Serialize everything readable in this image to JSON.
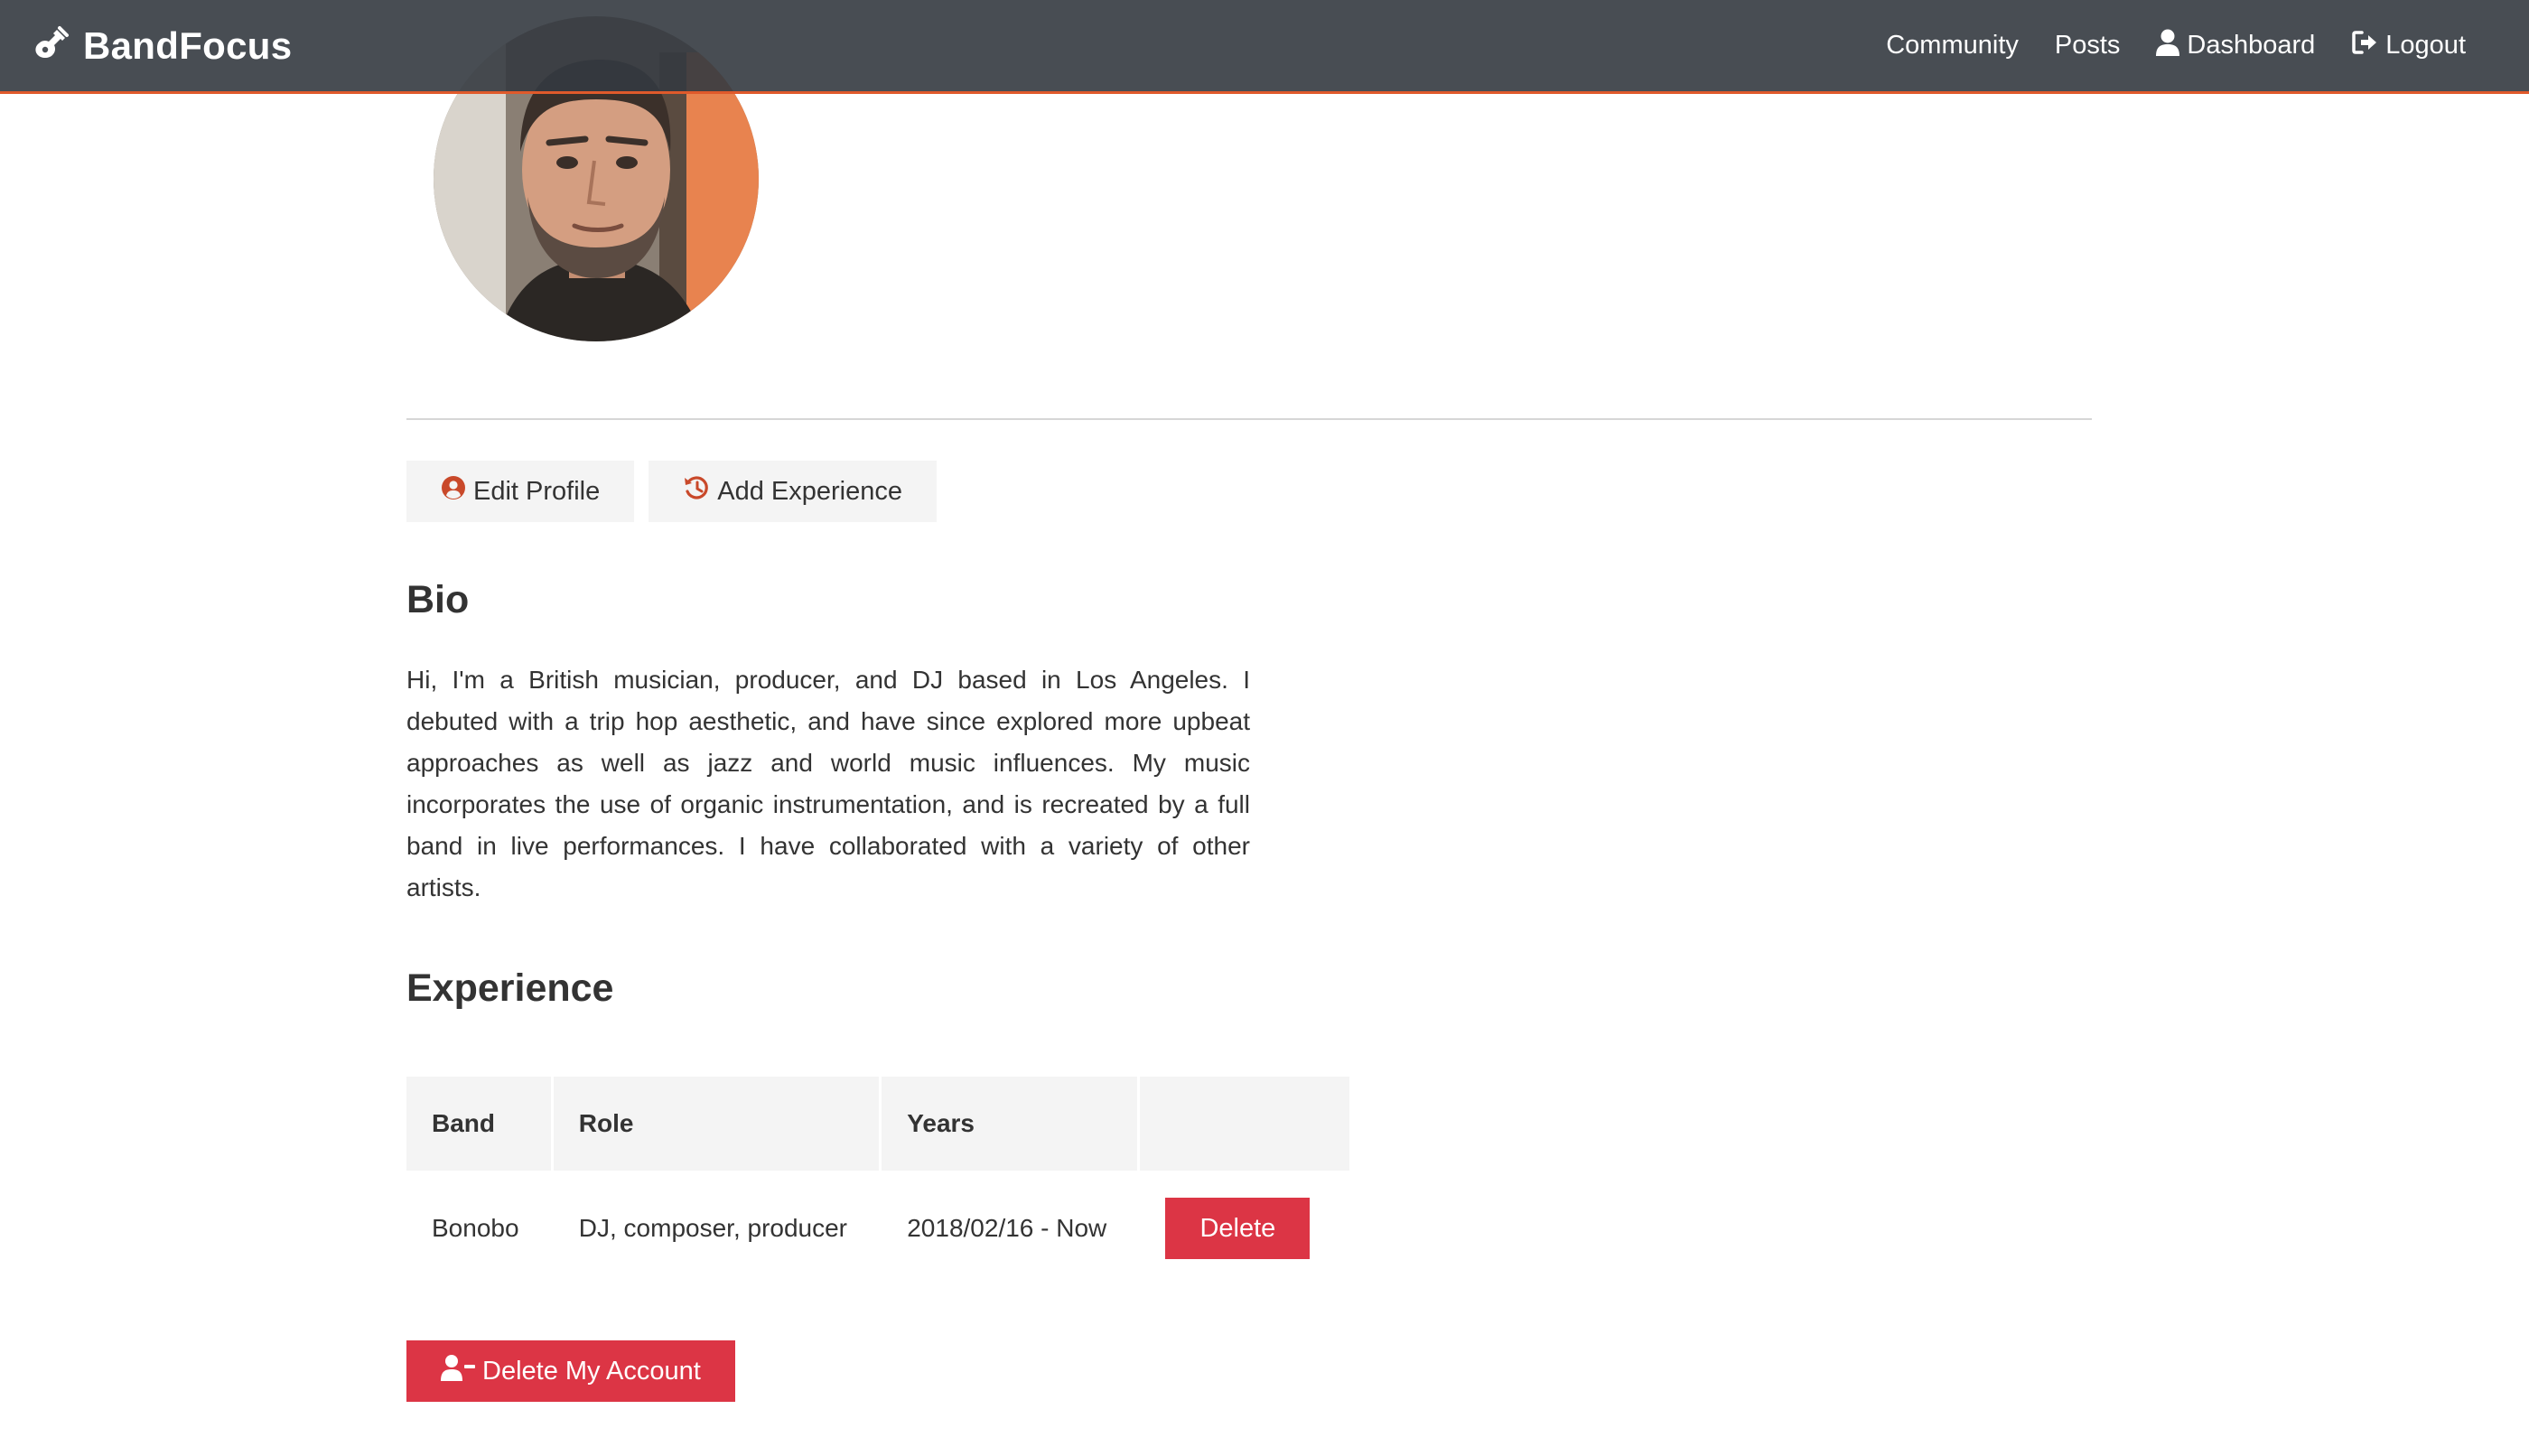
{
  "navbar": {
    "brand": "BandFocus",
    "links": [
      {
        "label": "Community",
        "icon": null
      },
      {
        "label": "Posts",
        "icon": null
      },
      {
        "label": "Dashboard",
        "icon": "user-icon"
      },
      {
        "label": "Logout",
        "icon": "sign-out-icon"
      }
    ],
    "accent_color": "#e05a2b"
  },
  "actions": {
    "edit_profile": "Edit Profile",
    "add_experience": "Add Experience"
  },
  "bio": {
    "heading": "Bio",
    "text": "Hi, I'm a British musician, producer, and DJ based in Los Angeles. I debuted with a trip hop aesthetic, and have since explored more upbeat approaches as well as jazz and world music influences. My music incorporates the use of organic instrumentation, and is recreated by a full band in live performances. I have collaborated with a variety of other artists."
  },
  "experience": {
    "heading": "Experience",
    "columns": [
      "Band",
      "Role",
      "Years",
      ""
    ],
    "rows": [
      {
        "band": "Bonobo",
        "role": "DJ, composer, producer",
        "years": "2018/02/16 - Now",
        "delete_label": "Delete"
      }
    ]
  },
  "delete_account": "Delete My Account",
  "colors": {
    "danger": "#dc3545",
    "icon_accent": "#c9492a"
  }
}
